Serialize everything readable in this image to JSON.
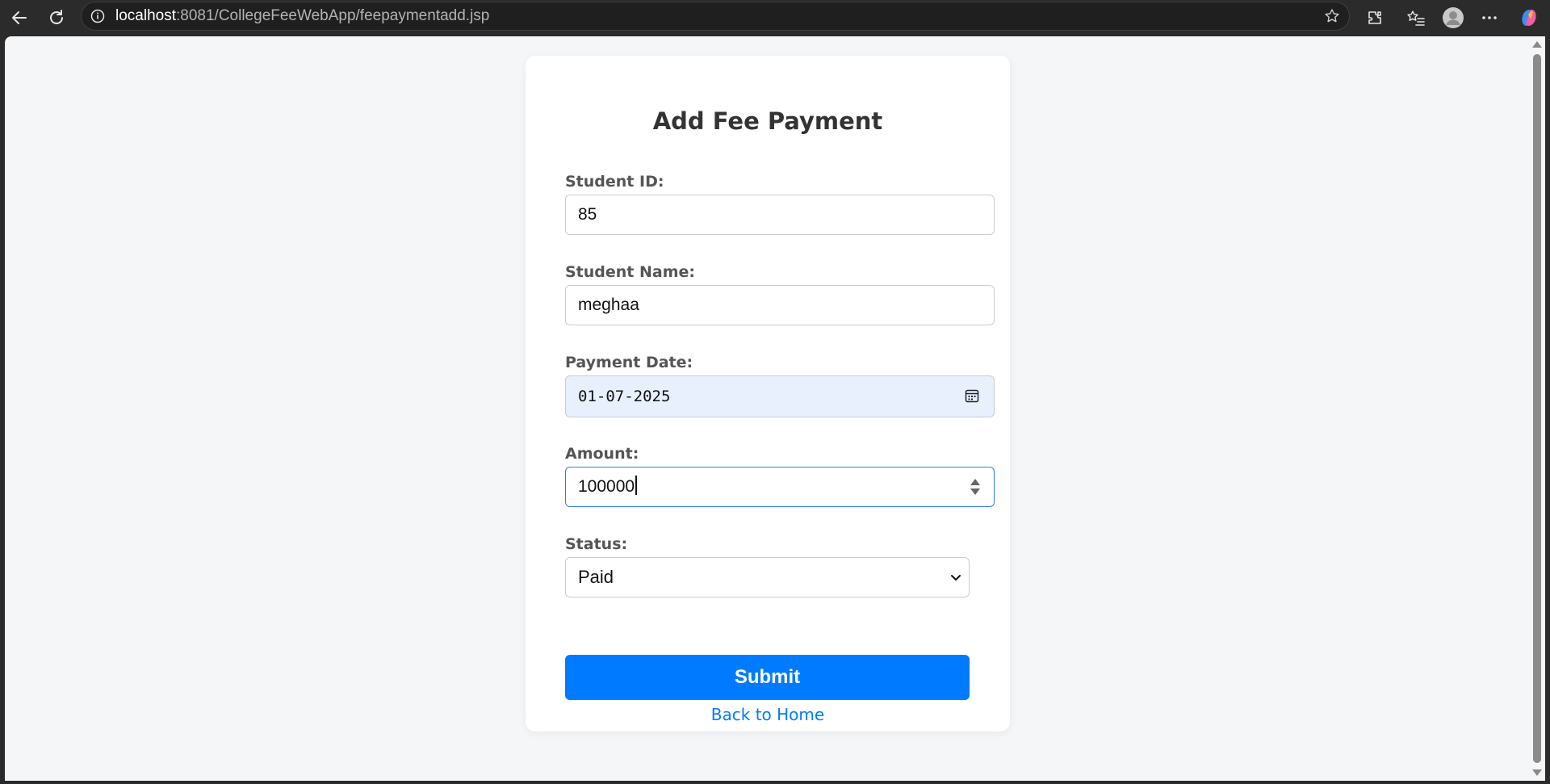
{
  "browser": {
    "url_host": "localhost",
    "url_path": ":8081/CollegeFeeWebApp/feepaymentadd.jsp"
  },
  "form": {
    "title": "Add Fee Payment",
    "student_id": {
      "label": "Student ID:",
      "value": "85"
    },
    "student_name": {
      "label": "Student Name:",
      "value": "meghaa"
    },
    "payment_date": {
      "label": "Payment Date:",
      "value": "01-07-2025"
    },
    "amount": {
      "label": "Amount:",
      "value": "100000"
    },
    "status": {
      "label": "Status:",
      "value": "Paid"
    },
    "submit_label": "Submit",
    "back_link": "Back to Home"
  },
  "colors": {
    "primary": "#007bff",
    "page_bg": "#f4f6f8",
    "date_field_bg": "#e8f0fe"
  }
}
